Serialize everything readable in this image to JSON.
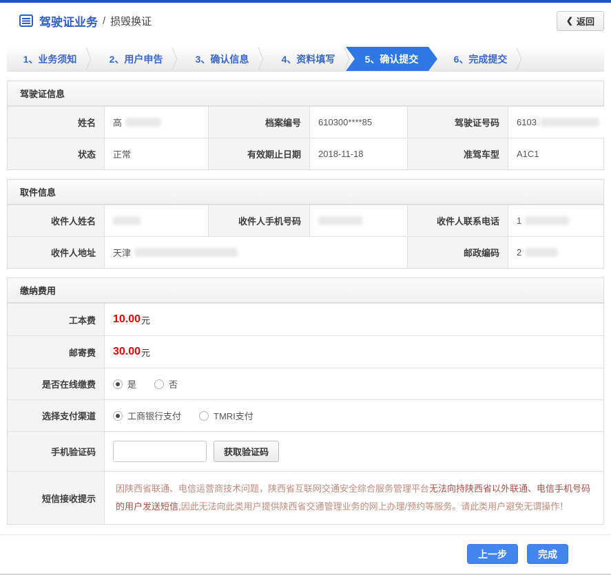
{
  "header": {
    "title": "驾驶证业务",
    "separator": "/",
    "subtitle": "损毁换证",
    "back_chevron": "❮",
    "back_label": "返回"
  },
  "steps": [
    {
      "label": "1、业务须知",
      "active": false
    },
    {
      "label": "2、用户申告",
      "active": false
    },
    {
      "label": "3、确认信息",
      "active": false
    },
    {
      "label": "4、资料填写",
      "active": false
    },
    {
      "label": "5、确认提交",
      "active": true
    },
    {
      "label": "6、完成提交",
      "active": false
    }
  ],
  "license_info": {
    "title": "驾驶证信息",
    "name_label": "姓名",
    "name_value": "高",
    "file_no_label": "档案编号",
    "file_no_value": "610300****85",
    "license_no_label": "驾驶证号码",
    "license_no_value": "6103",
    "status_label": "状态",
    "status_value": "正常",
    "valid_until_label": "有效期止日期",
    "valid_until_value": "2018-11-18",
    "vehicle_type_label": "准驾车型",
    "vehicle_type_value": "A1C1"
  },
  "pickup_info": {
    "title": "取件信息",
    "recipient_name_label": "收件人姓名",
    "recipient_name_value": "",
    "recipient_mobile_label": "收件人手机号码",
    "recipient_mobile_value": "",
    "recipient_phone_label": "收件人联系电话",
    "recipient_phone_value": "1",
    "recipient_address_label": "收件人地址",
    "recipient_address_value": "天津",
    "postal_code_label": "邮政编码",
    "postal_code_value": "2"
  },
  "payment": {
    "title": "缴纳费用",
    "cost_fee_label": "工本费",
    "cost_fee_value": "10.00",
    "mail_fee_label": "邮寄费",
    "mail_fee_value": "30.00",
    "fee_unit": "元",
    "online_pay_label": "是否在线缴费",
    "online_pay_options": [
      {
        "label": "是",
        "checked": true
      },
      {
        "label": "否",
        "checked": false
      }
    ],
    "channel_label": "选择支付渠道",
    "channel_options": [
      {
        "label": "工商银行支付",
        "checked": true
      },
      {
        "label": "TMRI支付",
        "checked": false
      }
    ],
    "sms_code_label": "手机验证码",
    "sms_code_value": "",
    "get_code_button": "获取验证码",
    "sms_note_label": "短信接收提示",
    "sms_note_part1": "因陕西省联通、电信运营商技术问题，陕西省互联网交通安全综合服务管理平台",
    "sms_note_part2": "无法向持陕西省以外联通、电信手机号码的用户发送短信,",
    "sms_note_part3": "因此无法向此类用户提供陕西省交通管理业务的网上办理/预约等服务。请此类用户避免无谓操作！"
  },
  "footer": {
    "prev_button": "上一步",
    "finish_button": "完成"
  },
  "colors": {
    "top_bar": "#1c57c4",
    "active_step": "#2e78e6",
    "accent_blue": "#2e5fc4",
    "button_blue": "#4285ee",
    "fee_red": "#e60000",
    "notice_light": "#c38b7e",
    "notice_dark": "#a8514a"
  }
}
